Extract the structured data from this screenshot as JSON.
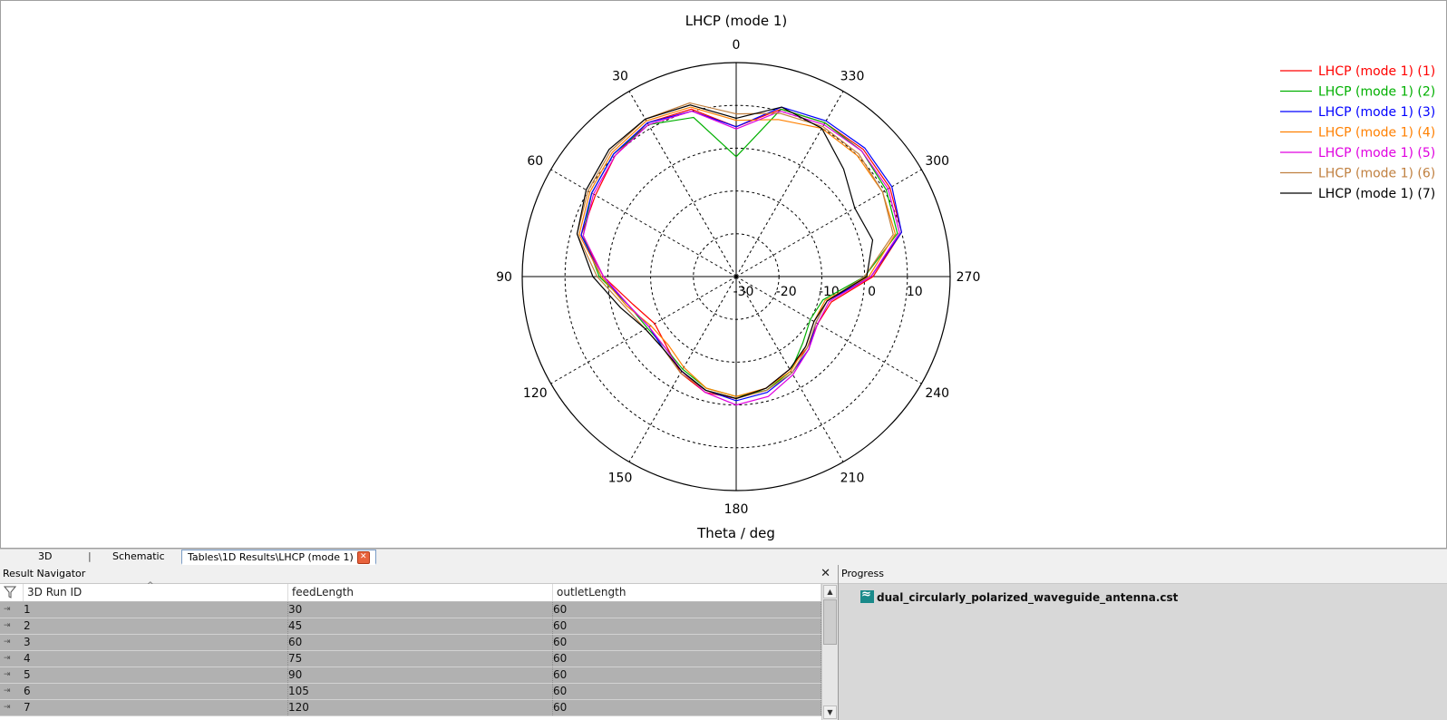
{
  "chart_data": {
    "type": "polar",
    "title": "LHCP (mode 1)",
    "xlabel": "Theta / deg",
    "angle_ticks": [
      "0",
      "330",
      "300",
      "270",
      "240",
      "210",
      "180",
      "150",
      "120",
      "90",
      "60",
      "30"
    ],
    "radial_ticks": [
      "-30",
      "-20",
      "-10",
      "0",
      "10"
    ],
    "radial_range": [
      -30,
      20
    ],
    "angle_direction": "counterclockwise, 0 at top",
    "grid": true,
    "legend_position": "top-right",
    "angles": [
      0,
      15,
      30,
      45,
      60,
      75,
      90,
      105,
      120,
      135,
      150,
      165,
      180,
      195,
      210,
      225,
      240,
      255,
      270,
      285,
      300,
      315,
      330,
      345
    ],
    "series": [
      {
        "name": "LHCP (mode 1) (1)",
        "color": "#ff0000",
        "values": [
          5.0,
          10.5,
          11.5,
          10.0,
          8.0,
          7.5,
          1.0,
          -5.0,
          -8.0,
          -7.0,
          -4.0,
          -2.0,
          -1.5,
          -3.0,
          -5.0,
          -6.5,
          -8.0,
          -7.0,
          2.0,
          10.0,
          11.5,
          12.0,
          11.5,
          10.5
        ]
      },
      {
        "name": "LHCP (mode 1) (2)",
        "color": "#00b000",
        "values": [
          -2.0,
          8.5,
          11.0,
          10.5,
          9.0,
          7.0,
          2.0,
          -4.0,
          -6.0,
          -6.5,
          -5.0,
          -3.0,
          -2.0,
          -2.5,
          -4.5,
          -8.0,
          -10.0,
          -9.0,
          0.0,
          9.0,
          10.5,
          11.5,
          11.5,
          10.5
        ]
      },
      {
        "name": "LHCP (mode 1) (3)",
        "color": "#0000ff",
        "values": [
          5.0,
          10.0,
          11.5,
          10.5,
          9.0,
          7.5,
          1.5,
          -4.0,
          -6.5,
          -6.0,
          -4.5,
          -2.5,
          -1.0,
          -2.0,
          -4.0,
          -6.0,
          -8.5,
          -8.0,
          1.5,
          10.0,
          12.0,
          12.5,
          12.0,
          11.0
        ]
      },
      {
        "name": "LHCP (mode 1) (4)",
        "color": "#ff8000",
        "values": [
          6.5,
          11.0,
          12.0,
          11.0,
          9.5,
          8.0,
          1.5,
          -3.5,
          -7.0,
          -7.5,
          -5.5,
          -3.0,
          -2.0,
          -3.0,
          -4.5,
          -7.0,
          -9.0,
          -8.5,
          1.0,
          8.5,
          9.5,
          10.0,
          10.0,
          8.0
        ]
      },
      {
        "name": "LHCP (mode 1) (5)",
        "color": "#e000e0",
        "values": [
          4.5,
          10.0,
          11.0,
          10.0,
          8.5,
          7.0,
          1.0,
          -4.0,
          -6.5,
          -6.5,
          -4.5,
          -2.0,
          0.0,
          -1.0,
          -3.5,
          -6.0,
          -8.0,
          -7.5,
          1.5,
          9.5,
          11.0,
          11.5,
          11.0,
          10.0
        ]
      },
      {
        "name": "LHCP (mode 1) (6)",
        "color": "#c08040",
        "values": [
          8.0,
          12.0,
          12.5,
          11.5,
          10.0,
          8.5,
          2.5,
          -3.0,
          -5.5,
          -6.0,
          -4.0,
          -2.5,
          -1.5,
          -2.5,
          -4.0,
          -6.5,
          -8.5,
          -8.0,
          0.0,
          8.0,
          9.5,
          10.5,
          10.5,
          9.5
        ]
      },
      {
        "name": "LHCP (mode 1) (7)",
        "color": "#000000",
        "values": [
          7.0,
          11.5,
          12.5,
          12.0,
          10.5,
          8.5,
          3.5,
          -2.0,
          -5.5,
          -6.0,
          -4.5,
          -2.5,
          -1.5,
          -3.0,
          -5.0,
          -7.0,
          -9.0,
          -8.0,
          0.5,
          3.0,
          2.0,
          5.5,
          10.0,
          11.0
        ]
      }
    ]
  },
  "tabs": [
    {
      "label": "3D"
    },
    {
      "label": "Schematic"
    },
    {
      "label": "Tables\\1D Results\\LHCP (mode 1)"
    }
  ],
  "result_navigator": {
    "title": "Result Navigator",
    "columns": [
      "3D Run ID",
      "feedLength",
      "outletLength"
    ],
    "rows": [
      [
        "1",
        "30",
        "60"
      ],
      [
        "2",
        "45",
        "60"
      ],
      [
        "3",
        "60",
        "60"
      ],
      [
        "4",
        "75",
        "60"
      ],
      [
        "5",
        "90",
        "60"
      ],
      [
        "6",
        "105",
        "60"
      ],
      [
        "7",
        "120",
        "60"
      ]
    ]
  },
  "progress": {
    "title": "Progress",
    "item": "dual_circularly_polarized_waveguide_antenna.cst"
  }
}
